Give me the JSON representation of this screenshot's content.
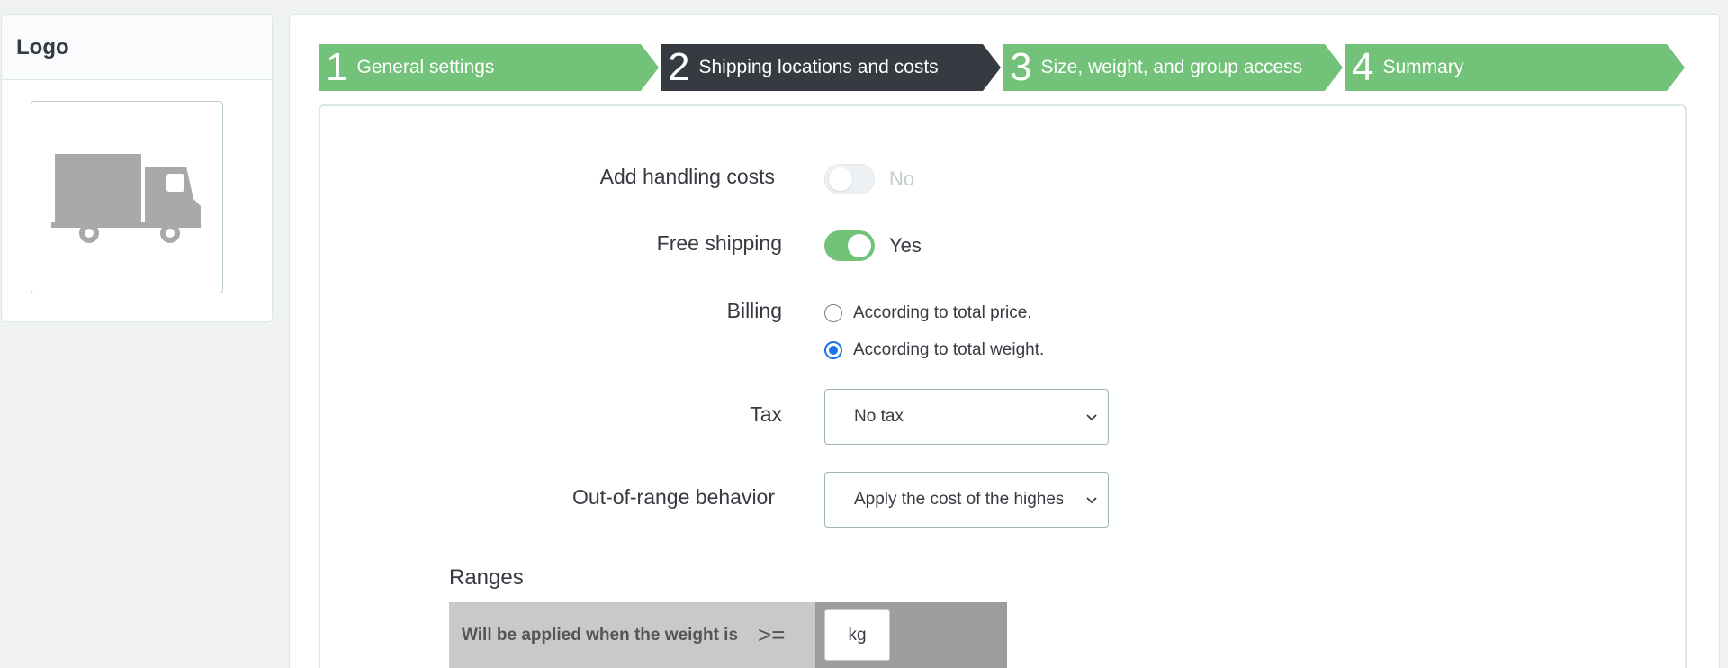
{
  "logo_panel": {
    "title": "Logo",
    "image_icon": "truck-icon"
  },
  "steps": [
    {
      "number": "1",
      "label": "General settings",
      "active": false
    },
    {
      "number": "2",
      "label": "Shipping locations and costs",
      "active": true
    },
    {
      "number": "3",
      "label": "Size, weight, and group access",
      "active": false
    },
    {
      "number": "4",
      "label": "Summary",
      "active": false
    }
  ],
  "form": {
    "handling_costs": {
      "label": "Add handling costs",
      "value": "No",
      "enabled": false
    },
    "free_shipping": {
      "label": "Free shipping",
      "value": "Yes",
      "enabled": true
    },
    "billing": {
      "label": "Billing",
      "options": [
        "According to total price.",
        "According to total weight."
      ],
      "selected": "According to total weight."
    },
    "tax": {
      "label": "Tax",
      "value": "No tax"
    },
    "out_of_range": {
      "label": "Out-of-range behavior",
      "value": "Apply the cost of the highest defined range"
    }
  },
  "ranges": {
    "title": "Ranges",
    "condition_label": "Will be applied when the weight is",
    "operator": ">=",
    "unit": "kg"
  },
  "colors": {
    "accent": "#72c279",
    "active_step": "#363a41",
    "radio": "#1a73e8"
  }
}
